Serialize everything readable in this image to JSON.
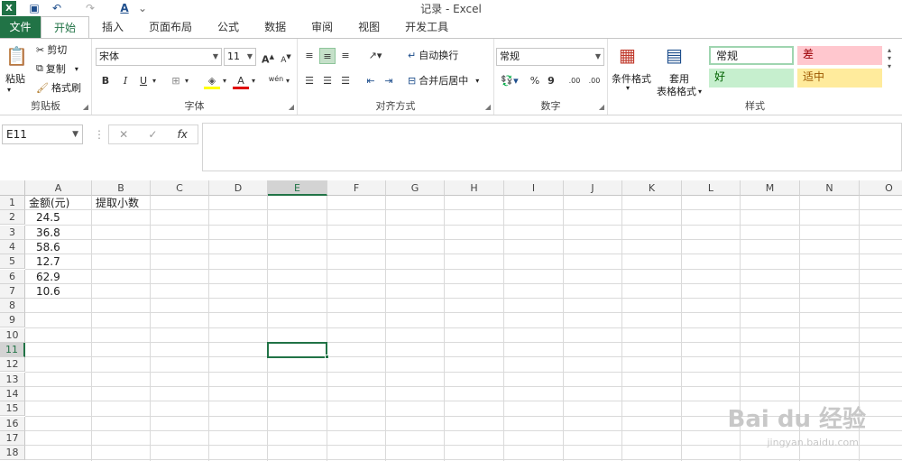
{
  "window": {
    "title": "记录 - Excel",
    "app_logo": "X"
  },
  "quick_access": {
    "undo_glyph": "↶",
    "redo_glyph": "↷",
    "font_color_glyph": "A",
    "more_glyph": "⌄"
  },
  "tabs": [
    "文件",
    "开始",
    "插入",
    "页面布局",
    "公式",
    "数据",
    "审阅",
    "视图",
    "开发工具"
  ],
  "ribbon": {
    "clipboard": {
      "label": "剪贴板",
      "paste": "粘贴",
      "cut": "剪切",
      "copy": "复制",
      "format_painter": "格式刷"
    },
    "font": {
      "label": "字体",
      "font_name": "宋体",
      "font_size": "11",
      "bold": "B",
      "italic": "I",
      "underline": "U",
      "grow": "A",
      "shrink": "A",
      "color_letter": "A",
      "wen": "wén"
    },
    "alignment": {
      "label": "对齐方式",
      "wrap_text": "自动换行",
      "merge_center": "合并后居中"
    },
    "number": {
      "label": "数字",
      "format": "常规",
      "percent": "%",
      "comma": "9",
      "inc_decimal": ".00",
      "dec_decimal": ".00"
    },
    "styles": {
      "label": "样式",
      "conditional_format": "条件格式",
      "table_format_line1": "套用",
      "table_format_line2": "表格格式",
      "cells": [
        {
          "text": "常规",
          "bg": "#ffffff",
          "color": "#222222"
        },
        {
          "text": "差",
          "bg": "#ffc7ce",
          "color": "#9c0006"
        },
        {
          "text": "好",
          "bg": "#c6efce",
          "color": "#006100"
        },
        {
          "text": "适中",
          "bg": "#ffeb9c",
          "color": "#9c5700"
        }
      ]
    }
  },
  "formula_bar": {
    "name_box": "E11",
    "cancel": "✕",
    "enter": "✓",
    "fx": "fx",
    "value": ""
  },
  "sheet": {
    "columns": [
      "A",
      "B",
      "C",
      "D",
      "E",
      "F",
      "G",
      "H",
      "I",
      "J",
      "K",
      "L",
      "M",
      "N",
      "O"
    ],
    "selected_column": "E",
    "selected_row": "11",
    "rows": [
      "1",
      "2",
      "3",
      "4",
      "5",
      "6",
      "7",
      "8",
      "9",
      "10",
      "11",
      "12",
      "13",
      "14",
      "15",
      "16",
      "17",
      "18"
    ],
    "cells": {
      "A1": "金额(元)",
      "B1": "提取小数",
      "A2": "24.5",
      "A3": "36.8",
      "A4": "58.6",
      "A5": "12.7",
      "A6": "62.9",
      "A7": "10.6"
    }
  },
  "watermark": {
    "main": "Bai du 经验",
    "sub": "jingyan.baidu.com"
  }
}
